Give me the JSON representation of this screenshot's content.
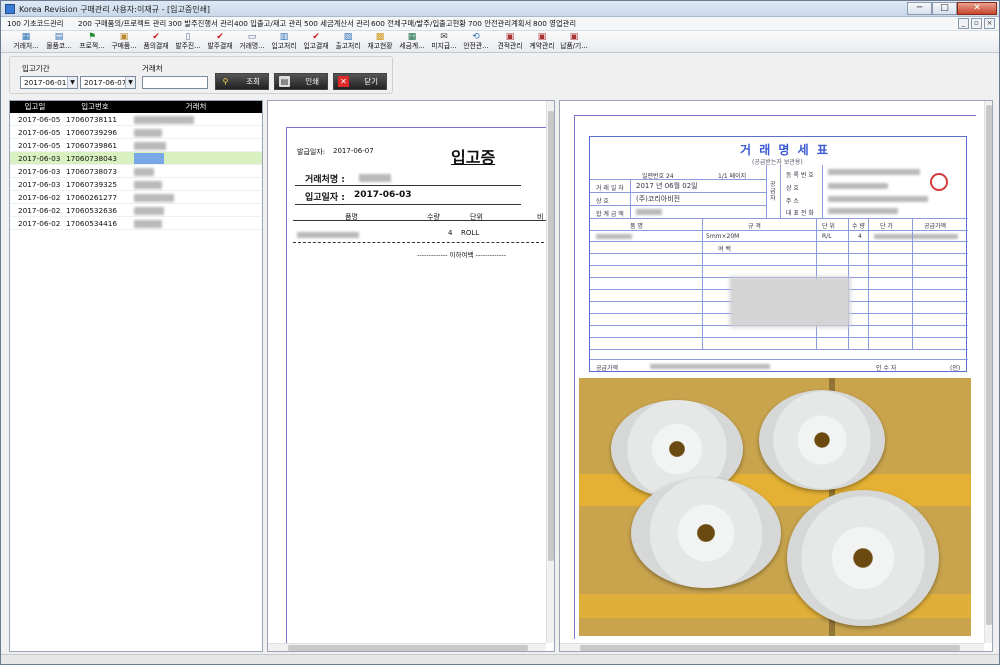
{
  "window": {
    "title": "Korea Revision  구매관리 사용자:이재규 - [입고증인쇄]",
    "minimize": "─",
    "maximize": "□",
    "close": "✕"
  },
  "menu": [
    "100 기초코드관리",
    "200 구매품의/프로젝트 관리",
    "300 발주진행서 관리",
    "400 입출고/재고 관리",
    "500 세금계산서 관리",
    "600 전체구매/발주/입출고현황",
    "700 안전관리계획서",
    "800 영업관리"
  ],
  "toolbar": [
    {
      "label": "거래처...",
      "icon": "table-icon"
    },
    {
      "label": "물품코...",
      "icon": "box-icon"
    },
    {
      "label": "프로젝...",
      "icon": "flag-icon"
    },
    {
      "label": "구매품...",
      "icon": "cart-icon"
    },
    {
      "label": "품의결재",
      "icon": "check-icon"
    },
    {
      "label": "발주진...",
      "icon": "doc-icon"
    },
    {
      "label": "발주결재",
      "icon": "check-icon"
    },
    {
      "label": "거래명...",
      "icon": "doc-icon"
    },
    {
      "label": "입고처리",
      "icon": "inbox-icon"
    },
    {
      "label": "입고결재",
      "icon": "check-icon"
    },
    {
      "label": "출고처리",
      "icon": "outbox-icon"
    },
    {
      "label": "재고현황",
      "icon": "chart-icon"
    },
    {
      "label": "세금계...",
      "icon": "calc-icon"
    },
    {
      "label": "미지급...",
      "icon": "mail-icon"
    },
    {
      "label": "안전관...",
      "icon": "shield-icon"
    },
    {
      "label": "견적관리",
      "icon": "book-icon"
    },
    {
      "label": "계약관리",
      "icon": "book-icon"
    },
    {
      "label": "납품/기...",
      "icon": "book-icon"
    }
  ],
  "filter": {
    "period_label": "입고기간",
    "date_from": "2017-06-01",
    "date_to": "2017-06-07",
    "vendor_label": "거래처",
    "vendor_value": "",
    "search_btn": "조회",
    "print_btn": "인쇄",
    "close_btn": "닫기"
  },
  "list": {
    "columns": [
      "입고일",
      "입고번호",
      "거래처"
    ],
    "rows": [
      {
        "date": "2017-06-05",
        "no": "17060738111"
      },
      {
        "date": "2017-06-05",
        "no": "17060739296"
      },
      {
        "date": "2017-06-05",
        "no": "17060739861"
      },
      {
        "date": "2017-06-03",
        "no": "17060738043"
      },
      {
        "date": "2017-06-03",
        "no": "17060738073"
      },
      {
        "date": "2017-06-03",
        "no": "17060739325"
      },
      {
        "date": "2017-06-02",
        "no": "17060261277"
      },
      {
        "date": "2017-06-02",
        "no": "17060532636"
      },
      {
        "date": "2017-06-02",
        "no": "17060534416"
      }
    ]
  },
  "receipt": {
    "issue_label": "발급일자:",
    "issue_date": "2017-06-07",
    "title": "입고증",
    "vendor_label": "거래처명 :",
    "date_label": "입고일자 :",
    "date_value": "2017-06-03",
    "col_item": "품명",
    "col_qty": "수량",
    "col_unit": "단위",
    "col_extra": "비",
    "item_qty": "4",
    "item_unit": "ROLL",
    "footer": "------------- 이하여백 -------------"
  },
  "statement": {
    "title": "거 래 명 세 표",
    "subtitle": "(공급받는자 보관용)",
    "serial": "일련번호 24",
    "page": "1/1 페이지",
    "date_label": "거 래 일 자",
    "date_value": "2017 년 06월 02일",
    "recipient_label": "상        호",
    "recipient_value": "(주)코리아비전",
    "sum_label": "합 계 금 액",
    "supplier_labels": [
      "등 록 번 호",
      "상        호",
      "주        소",
      "대 표 전 화"
    ],
    "supplier_marker": "공급자",
    "cols": [
      "품        명",
      "규        격",
      "단 위",
      "수 량",
      "단  가",
      "공급가액"
    ],
    "spec": "5mm×20M",
    "unit": "R/L",
    "qty": "4",
    "extra": "여   백",
    "total_label": "공급가액",
    "receiver_label": "인 수 자",
    "seal": "(인)"
  }
}
